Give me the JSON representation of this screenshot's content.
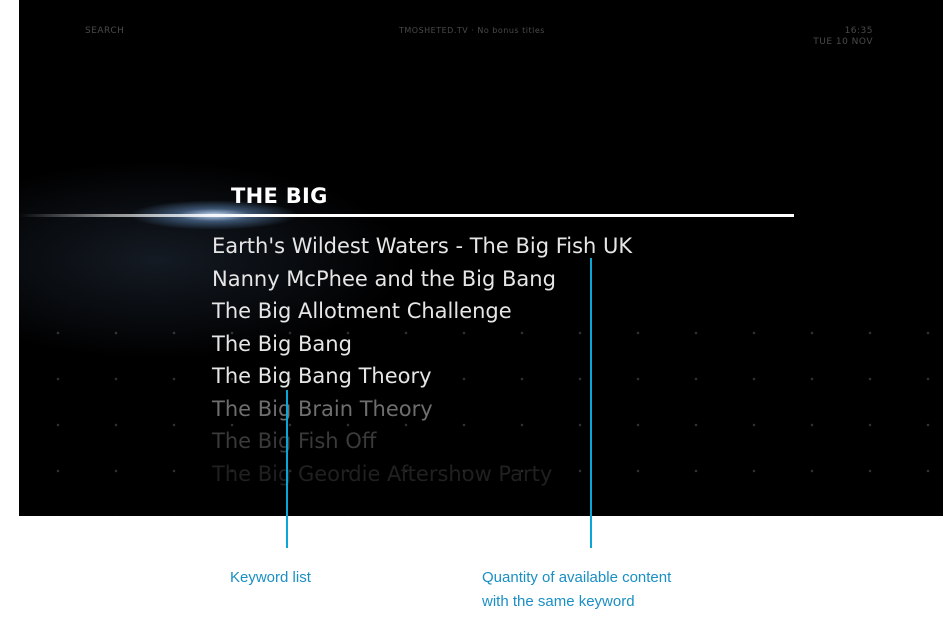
{
  "header": {
    "left": "SEARCH",
    "center": "TMOSHETED.TV · No bonus titles",
    "time": "16:35",
    "date": "TUE 10 NOV"
  },
  "search": {
    "query": "THE BIG",
    "results": [
      "Earth's Wildest Waters - The Big Fish UK",
      "Nanny McPhee and the Big Bang",
      "The Big Allotment Challenge",
      "The Big Bang",
      "The Big Bang Theory",
      "The Big Brain Theory",
      "The Big Fish Off",
      "The Big Geordie Aftershow Party"
    ]
  },
  "annotations": {
    "keyword_list": "Keyword list",
    "quantity_line1": "Quantity of available content",
    "quantity_line2": "with the same keyword"
  },
  "colors": {
    "accent": "#0aa6d6",
    "caption": "#1a8fc4",
    "background": "#000000"
  }
}
